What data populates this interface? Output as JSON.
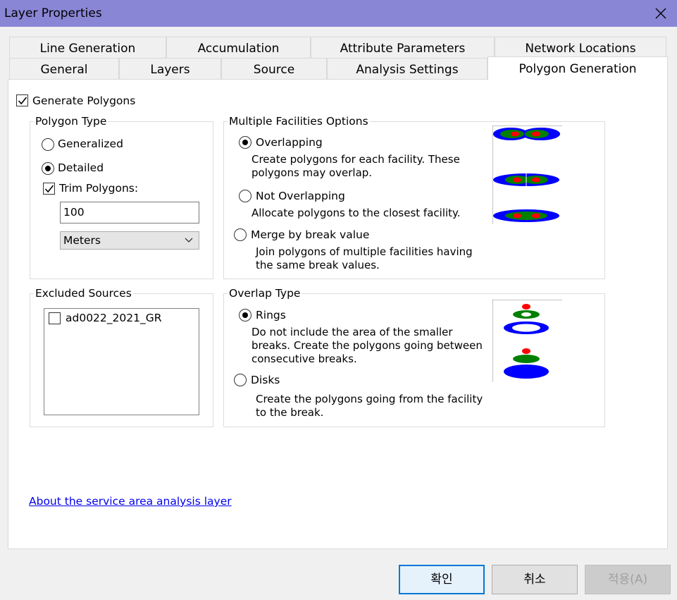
{
  "window": {
    "title": "Layer Properties"
  },
  "tabs_row1": [
    {
      "label": "Line Generation"
    },
    {
      "label": "Accumulation"
    },
    {
      "label": "Attribute Parameters"
    },
    {
      "label": "Network Locations"
    }
  ],
  "tabs_row2": [
    {
      "label": "General"
    },
    {
      "label": "Layers"
    },
    {
      "label": "Source"
    },
    {
      "label": "Analysis Settings"
    },
    {
      "label": "Polygon Generation",
      "active": true
    }
  ],
  "generate_polygons": {
    "label": "Generate Polygons",
    "checked": true
  },
  "polygon_type": {
    "title": "Polygon Type",
    "generalized": {
      "label": "Generalized",
      "selected": false
    },
    "detailed": {
      "label": "Detailed",
      "selected": true
    },
    "trim": {
      "label": "Trim Polygons:",
      "checked": true,
      "value": "100",
      "unit": "Meters"
    }
  },
  "multiple_facilities": {
    "title": "Multiple Facilities Options",
    "overlapping": {
      "label": "Overlapping",
      "selected": true,
      "desc": "Create polygons for each facility. These polygons may overlap."
    },
    "not_overlapping": {
      "label": "Not Overlapping",
      "selected": false,
      "desc": "Allocate polygons to the closest facility."
    },
    "merge": {
      "label": "Merge by break value",
      "selected": false,
      "desc": "Join polygons of multiple facilities having the same break values."
    }
  },
  "excluded_sources": {
    "title": "Excluded Sources",
    "items": [
      {
        "label": "ad0022_2021_GR",
        "checked": false
      }
    ]
  },
  "overlap_type": {
    "title": "Overlap Type",
    "rings": {
      "label": "Rings",
      "selected": true,
      "desc": "Do not include the area of the smaller breaks. Create the polygons going between consecutive breaks."
    },
    "disks": {
      "label": "Disks",
      "selected": false,
      "desc": "Create the polygons going from the facility to the break."
    }
  },
  "help_link": "About the service area analysis layer",
  "buttons": {
    "ok": "확인",
    "cancel": "취소",
    "apply": "적용(A)"
  },
  "colors": {
    "title_bar": "#8a86d6",
    "ring_outer": "#0000ff",
    "ring_mid": "#008000",
    "ring_inner": "#ff0000"
  }
}
